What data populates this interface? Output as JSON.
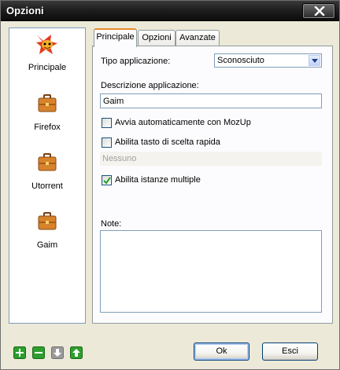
{
  "window": {
    "title": "Opzioni"
  },
  "sidebar": {
    "items": [
      {
        "label": "Principale",
        "icon": "fox-mascot-icon"
      },
      {
        "label": "Firefox",
        "icon": "briefcase-icon"
      },
      {
        "label": "Utorrent",
        "icon": "briefcase-icon"
      },
      {
        "label": "Gaim",
        "icon": "briefcase-icon"
      }
    ]
  },
  "tabs": [
    "Principale",
    "Opzioni",
    "Avanzate"
  ],
  "form": {
    "app_type_label": "Tipo applicazione:",
    "app_type_value": "Sconosciuto",
    "description_label": "Descrizione applicazione:",
    "description_value": "Gaim",
    "autostart_label": "Avvia automaticamente con MozUp",
    "autostart_checked": false,
    "hotkey_label": "Abilita tasto di scelta rapida",
    "hotkey_checked": false,
    "hotkey_value": "Nessuno",
    "multi_instance_label": "Abilita istanze multiple",
    "multi_instance_checked": true,
    "notes_label": "Note:",
    "notes_value": ""
  },
  "buttons": {
    "ok": "Ok",
    "cancel": "Esci"
  },
  "colors": {
    "add": "#2e9e2e",
    "remove": "#2e9e2e",
    "down": "#9a9a9a",
    "up": "#2e9e2e"
  }
}
